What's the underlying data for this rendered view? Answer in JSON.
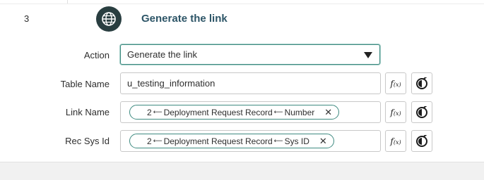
{
  "step": {
    "number": "3",
    "icon": "globe-icon",
    "title": "Generate the link"
  },
  "fields": {
    "action": {
      "label": "Action",
      "value": "Generate the link",
      "icon": "caret-down-icon"
    },
    "table_name": {
      "label": "Table Name",
      "value": "u_testing_information"
    },
    "link_name": {
      "label": "Link Name",
      "pill": {
        "index": "2",
        "record": "Deployment Request Record",
        "field": "Number",
        "arrow": "⟵"
      }
    },
    "rec_sys_id": {
      "label": "Rec Sys Id",
      "pill": {
        "index": "2",
        "record": "Deployment Request Record",
        "field": "Sys ID",
        "arrow": "⟵"
      }
    }
  },
  "buttons": {
    "fx_label": "f",
    "fx_sub": "(x)",
    "data_pill_icon": "data-pill-picker-icon",
    "remove_label": "✕"
  },
  "colors": {
    "accent": "#3e8a80",
    "icon_bg": "#293e40",
    "title": "#2d5567"
  }
}
